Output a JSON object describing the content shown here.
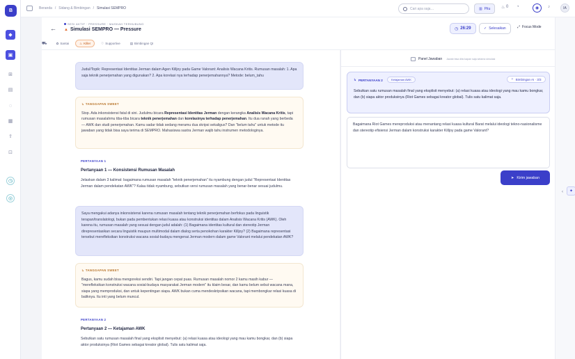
{
  "topbar": {
    "breadcrumbs": [
      "Beranda",
      "/",
      "Sidang & Bimbingan",
      "/",
      "Simulasi SEMPRO"
    ],
    "search_placeholder": "Cari apa saja…",
    "pill_label": "Pitu",
    "counter": "0",
    "avatar": "IA"
  },
  "session": {
    "live_label": "SESI AKTIF · PRESSURE · MASKAH TERHUBUNG",
    "title": "Simulasi SEMPRO — Pressure",
    "timer": "26:29",
    "finish_label": "Selesaikan",
    "focus_label": "Focus Mode"
  },
  "modes": [
    {
      "label": "Santai"
    },
    {
      "label": "Killer"
    },
    {
      "label": "Supportive"
    },
    {
      "label": "Bimbingan QI"
    }
  ],
  "chat": {
    "user1": "Judul/Topik: Representasi Identitas Jerman dalam Agen Killjoy pada Game Valorant: Analisis Wacana Kritis. Rumusan masalah: 1. Apa saja teknik penerjemahan yang digunakan? 2. Apa korelasi nya terhadap penerjemahannya? Metode: belum_tahu",
    "ai1_label": "TANGGAPAN SWEET",
    "ai1_p1": "Stop. Ada inkonsistensi fatal di sini. Judulmu bicara ",
    "ai1_b1": "Representasi Identitas Jerman",
    "ai1_p2": " dengan kerangka ",
    "ai1_b2": "Analisis Wacana Kritis",
    "ai1_p3": ", tapi rumusan masalahmu tiba-tiba bicara ",
    "ai1_b3": "teknik penerjemahan",
    "ai1_p4": " dan ",
    "ai1_b4": "korelasinya terhadap penerjemahan",
    "ai1_p5": ". Itu dua ranah yang berbeda — AWK dan studi penerjemahan. Kamu sadar tidak sedang meramu dua skripsi sekaligus? Dan \"belum tahu\" untuk metode itu jawaban yang tidak bisa saya terima di SEMPRO. Mahasiswa sastra Jerman wajib tahu instrumen metodologinya.",
    "q1_label": "PERTANYAAN 1",
    "q1_title": "Pertanyaan 1 — Konsistensi Rumusan Masalah",
    "q1_text": "Jelaskan dalam 3 kalimat: bagaimana rumusan masalah \"teknik penerjemahan\" itu nyambung dengan judul \"Representasi Identitas Jerman dalam pendekatan AWK\"? Kalau tidak nyambung, sebutkan versi rumusan masalah yang benar-benar sesuai judulmu.",
    "user2": "Saya mengakui adanya inkonsistensi karena rumusan masalah tentang teknik penerjemahan berfokus pada linguistik terapan/translatologi, bukan pada pembentukan relasi kuasa atau konstruksi identitas dalam Analisis Wacana Kritis (AWK). Oleh karena itu, rumusan masalah yang sesuai dengan judul adalah: (1) Bagaimana identitas kultural dan stereotip Jerman direpresentasikan secara linguistik maupun multimodal dalam dialog serta penokohan karakter Killjoy? (2) Bagaimana representasi tersebut merefleksikan konstruksi wacana sosial-budaya mengenai Jerman modern dalam game Valorant melalui pendekatan AWK?",
    "ai2_label": "TANGGAPAN SWEET",
    "ai2_text": "Bagus, kamu sudah bisa mengoreksi sendiri. Tapi jangan cepat puas. Rumusan masalah nomor 2 kamu masih kabur — \"merefleksikan konstruksi wacana sosial-budaya masyarakat Jerman modern\" itu klaim besar, dan kamu belum sebut wacana mana, siapa yang memproduksi, dan untuk kepentingan siapa. AWK bukan cuma mendeskripsikan wacana, tapi membongkar relasi kuasa di baliknya. Itu inti yang belum muncul.",
    "q2_label": "PERTANYAAN 2",
    "q2_title": "Pertanyaan 2 — Ketajaman AWK",
    "q2_text": "Sebutkan satu rumusan masalah final yang eksplisit menyebut: (a) relasi kuasa atau ideologi yang mau kamu bongkar, dan (b) siapa aktor produksinya (Riot Games sebagai kreator global). Tulis satu kalimat saja."
  },
  "panel": {
    "title": "Panel Jawaban",
    "subtitle": "Jawab bisa diisi kapan saja selama simulasi",
    "q_label": "PERTANYAAN 2",
    "q_chip": "Ketajaman AWK",
    "q_hint": "Bimbingan AI · 3/3",
    "q_text": "Sebutkan satu rumusan masalah final yang eksplisit menyebut: (a) relasi kuasa atau ideologi yang mau kamu bongkar, dan (b) siapa aktor produksinya (Riot Games sebagai kreator global). Tulis satu kalimat saja.",
    "answer_text": "Bagaimana Riot Games mereproduksi atau menantang relasi kuasa kultural Barat melalui ideologi tekno-nasionalisme dan stereotip efisiensi Jerman dalam konstruksi karakter Killjoy pada game Valorant?",
    "send_label": "Kirim jawaban"
  }
}
